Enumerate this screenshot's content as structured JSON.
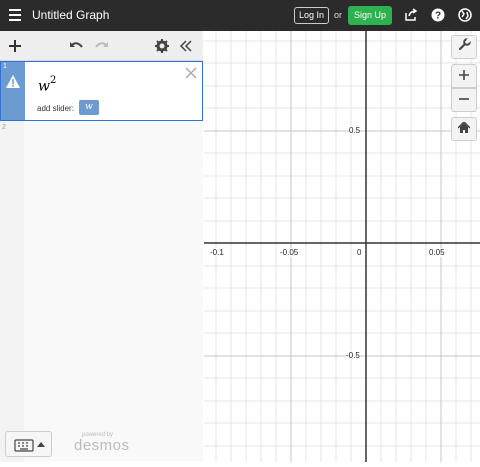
{
  "header": {
    "title": "Untitled Graph",
    "login_label": "Log In",
    "or_label": "or",
    "signup_label": "Sign Up",
    "icons": [
      "share-icon",
      "help-icon",
      "globe-icon"
    ]
  },
  "toolbar": {
    "icons": [
      "add-icon",
      "undo-icon",
      "redo-icon",
      "settings-icon",
      "collapse-icon"
    ]
  },
  "expressions": [
    {
      "number": "1",
      "latex_base": "w",
      "latex_exp": "2",
      "warning": true,
      "slider_label": "add slider:",
      "slider_var": "w"
    },
    {
      "number": "2"
    }
  ],
  "footer": {
    "powered_by": "powered by",
    "brand": "desmos"
  },
  "graph": {
    "x_ticks": [
      "-0.1",
      "-0.05",
      "0",
      "0.05"
    ],
    "y_ticks": [
      "0.5",
      "-0.5"
    ]
  },
  "colors": {
    "topbar": "#2b2b2b",
    "signup": "#2eb24f",
    "expr_accent": "#6b9bd0"
  }
}
